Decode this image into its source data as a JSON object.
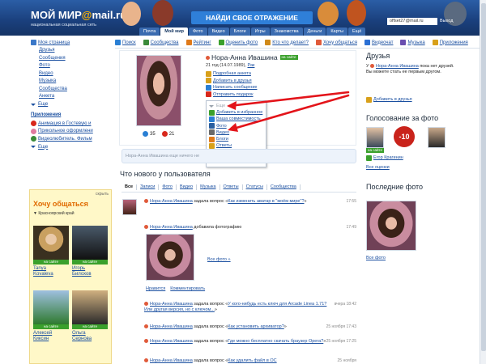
{
  "header": {
    "logo": "МОЙ МИР@mail.ru",
    "logo_main": "МОЙ МИР",
    "logo_dog": "@",
    "logo_domain": "mail.ru",
    "logo_subtitle": "национальная социальная сеть",
    "slogan": "НАЙДИ СВОЕ ОТРАЖЕНИЕ",
    "user": "offset27@mail.ru",
    "exit": "Выход",
    "tabs": [
      "Почта",
      "Мой мир",
      "Фото",
      "Видео",
      "Блоги",
      "Игры",
      "Знакомства",
      "Деньги",
      "Карты",
      "Ещё"
    ],
    "active_tab": "Мой мир"
  },
  "toolbar": {
    "items": [
      {
        "label": "Поиск",
        "icon": "search-icon",
        "color": "#2a7fd4"
      },
      {
        "label": "Сообщества",
        "icon": "communities-icon",
        "color": "#3a8a3a"
      },
      {
        "label": "Рейтинг",
        "icon": "rating-icon",
        "color": "#e07a1a"
      },
      {
        "label": "Оценить фото",
        "icon": "rate-photo-icon",
        "color": "#3aa02c"
      },
      {
        "label": "Кто что делает?",
        "icon": "activity-icon",
        "color": "#d08a1a"
      },
      {
        "label": "Хочу общаться",
        "icon": "chat-icon",
        "color": "#e05a3a"
      },
      {
        "label": "Видеочат",
        "icon": "videochat-icon",
        "color": "#2a6fd4"
      },
      {
        "label": "Музыка",
        "icon": "music-icon",
        "color": "#6a4fb0"
      },
      {
        "label": "Приложения",
        "icon": "apps-icon",
        "color": "#d8a01a"
      }
    ]
  },
  "leftnav": {
    "items": [
      "Моя страница",
      "Друзья",
      "Сообщения",
      "Фото",
      "Видео",
      "Музыка",
      "Сообщества",
      "Анкета"
    ],
    "more": "Еще",
    "apps_title": "Приложения",
    "apps": [
      "Анимация в Гостевую и",
      "Прикольное оформлени",
      "Видеолюбитель. Фильм"
    ],
    "apps_more": "Еще"
  },
  "chat_widget": {
    "hide": "скрыть",
    "title": "Хочу общаться",
    "location": "▼ Красноярский край",
    "online_label": "на сайте",
    "people": [
      {
        "first": "Tanya",
        "last": "Kovaleva"
      },
      {
        "first": "Игорь",
        "last": "Билохов"
      },
      {
        "first": "Алексей",
        "last": "Киксин"
      },
      {
        "first": "Ольга",
        "last": "Сернова"
      }
    ]
  },
  "profile": {
    "name": "Нора-Анна Ивашина",
    "online": "на сайте",
    "age_prefix": "21 год (14.07.1989),",
    "zodiac": "Рак",
    "links": [
      "Подробная анкета",
      "Добавить в друзья",
      "Написать сообщение",
      "Отправить подарок"
    ],
    "stat_1": "35",
    "stat_2": "21",
    "dropdown": [
      "Еще",
      "Добавить в избранное",
      "Ваша совместимость",
      "Фото",
      "Видео",
      "Блоги",
      "Ответы",
      "Пожаловаться"
    ],
    "status_placeholder": "Нора-Анна Ивашина еще ничего не"
  },
  "feed": {
    "title": "Что нового у пользователя",
    "tabs": [
      "Все",
      "Записи",
      "Фото",
      "Видео",
      "Музыка",
      "Ответы",
      "Статусы",
      "Сообщества"
    ],
    "active_tab": "Все",
    "items": [
      {
        "author": "Нора-Анна Ивашина",
        "action": " задала вопрос «",
        "link": "Как изменить аватар в \"моём мире\"?",
        "tail": "»",
        "time": "17:55"
      },
      {
        "author": "Нора-Анна Ивашина",
        "action": " добавила фотографию",
        "link": "",
        "tail": "",
        "time": "17:49"
      },
      {
        "author": "Нора-Анна Ивашина",
        "action": " задала вопрос «",
        "link": "У кого-нибудь есть ключ для Arcade Linea 1.71? Или другая версия, но с ключом...",
        "tail": "»",
        "time": "вчера 18:42"
      },
      {
        "author": "Нора-Анна Ивашина",
        "action": " задала вопрос «",
        "link": "Как установить архиватор?",
        "tail": "»",
        "time": "25 ноября 17:43"
      },
      {
        "author": "Нора-Анна Ивашина",
        "action": " задала вопрос «",
        "link": "Где можно бесплатно скачать браузер Opera?",
        "tail": "»",
        "time": "25 ноября 17:25"
      },
      {
        "author": "Нора-Анна Ивашина",
        "action": " задала вопрос «",
        "link": "Как удалить файл в ОС",
        "tail": "",
        "time": "25 ноября"
      }
    ],
    "all_photos": "Все фото »",
    "actions": [
      "Нравится",
      "Комментировать"
    ]
  },
  "right": {
    "friends_title": "Друзья",
    "friends_text_1": "У ",
    "friends_name": "Нора-Анна Ивашина",
    "friends_text_2": " пока нет друзей.",
    "friends_text_3": "Вы можете стать ее первым другом.",
    "add_friends": "Добавить в друзья",
    "vote_title": "Голосование за фото",
    "vote_online": "на сайте",
    "vote_badge": "-10",
    "vote_user": "Егор Крагинин",
    "vote_all": "Все оценки",
    "last_photo_title": "Последние фото",
    "all_photos": "Все фото"
  },
  "colors": {
    "header": "#1c3f7a",
    "link": "#1a4fa0",
    "online": "#3aa02c",
    "chat_bg": "#fff8c8",
    "arrow": "#e3141a"
  }
}
